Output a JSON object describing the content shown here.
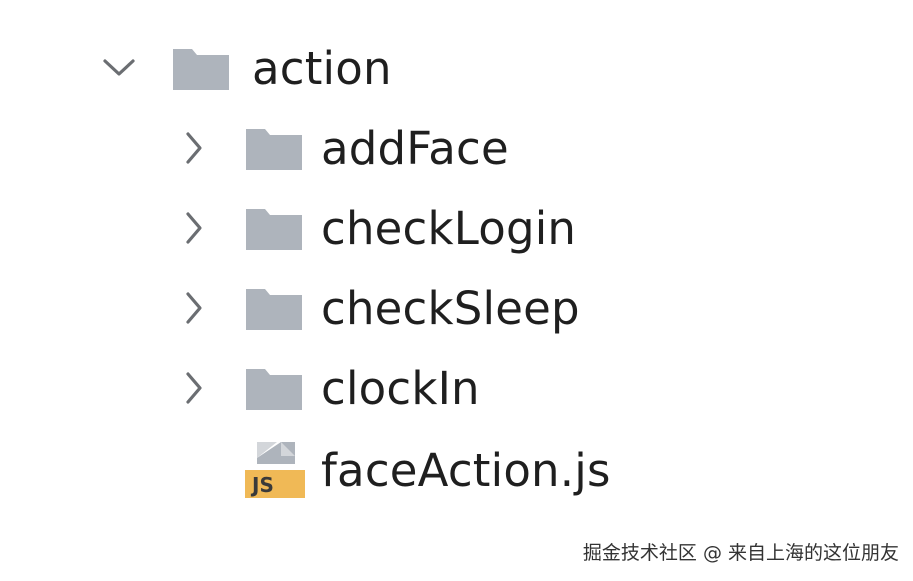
{
  "tree": {
    "root": {
      "label": "action",
      "expanded": true,
      "icon": "folder-icon"
    },
    "children": [
      {
        "label": "addFace",
        "type": "folder",
        "expanded": false
      },
      {
        "label": "checkLogin",
        "type": "folder",
        "expanded": false
      },
      {
        "label": "checkSleep",
        "type": "folder",
        "expanded": false
      },
      {
        "label": "clockIn",
        "type": "folder",
        "expanded": false
      },
      {
        "label": "faceAction.js",
        "type": "file",
        "badge": "JS"
      }
    ]
  },
  "watermark": "掘金技术社区 @ 来自上海的这位朋友",
  "colors": {
    "folder": "#aeb4bc",
    "chevron": "#6b6e72",
    "js_badge": "#f0b956",
    "text": "#1f1f1f"
  }
}
